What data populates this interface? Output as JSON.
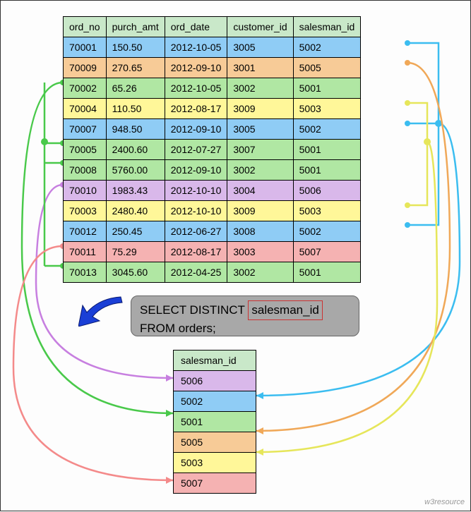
{
  "orders_table": {
    "headers": [
      "ord_no",
      "purch_amt",
      "ord_date",
      "customer_id",
      "salesman_id"
    ],
    "rows": [
      {
        "color": "c-blue",
        "cells": [
          "70001",
          "150.50",
          "2012-10-05",
          "3005",
          "5002"
        ]
      },
      {
        "color": "c-orange",
        "cells": [
          "70009",
          "270.65",
          "2012-09-10",
          "3001",
          "5005"
        ]
      },
      {
        "color": "c-green",
        "cells": [
          "70002",
          "65.26",
          "2012-10-05",
          "3002",
          "5001"
        ]
      },
      {
        "color": "c-yellow",
        "cells": [
          "70004",
          "110.50",
          "2012-08-17",
          "3009",
          "5003"
        ]
      },
      {
        "color": "c-blue",
        "cells": [
          "70007",
          "948.50",
          "2012-09-10",
          "3005",
          "5002"
        ]
      },
      {
        "color": "c-green",
        "cells": [
          "70005",
          "2400.60",
          "2012-07-27",
          "3007",
          "5001"
        ]
      },
      {
        "color": "c-green",
        "cells": [
          "70008",
          "5760.00",
          "2012-09-10",
          "3002",
          "5001"
        ]
      },
      {
        "color": "c-violet",
        "cells": [
          "70010",
          "1983.43",
          "2012-10-10",
          "3004",
          "5006"
        ]
      },
      {
        "color": "c-yellow",
        "cells": [
          "70003",
          "2480.40",
          "2012-10-10",
          "3009",
          "5003"
        ]
      },
      {
        "color": "c-blue",
        "cells": [
          "70012",
          "250.45",
          "2012-06-27",
          "3008",
          "5002"
        ]
      },
      {
        "color": "c-red",
        "cells": [
          "70011",
          "75.29",
          "2012-08-17",
          "3003",
          "5007"
        ]
      },
      {
        "color": "c-green",
        "cells": [
          "70013",
          "3045.60",
          "2012-04-25",
          "3002",
          "5001"
        ]
      }
    ]
  },
  "sql": {
    "line1_pre": "SELECT DISTINCT",
    "line1_boxed": "salesman_id",
    "line2": "FROM  orders;"
  },
  "result_table": {
    "header": "salesman_id",
    "rows": [
      {
        "color": "c-violet",
        "val": "5006"
      },
      {
        "color": "c-blue",
        "val": "5002"
      },
      {
        "color": "c-green",
        "val": "5001"
      },
      {
        "color": "c-orange",
        "val": "5005"
      },
      {
        "color": "c-yellow",
        "val": "5003"
      },
      {
        "color": "c-red",
        "val": "5007"
      }
    ]
  },
  "footer": "w3resource"
}
